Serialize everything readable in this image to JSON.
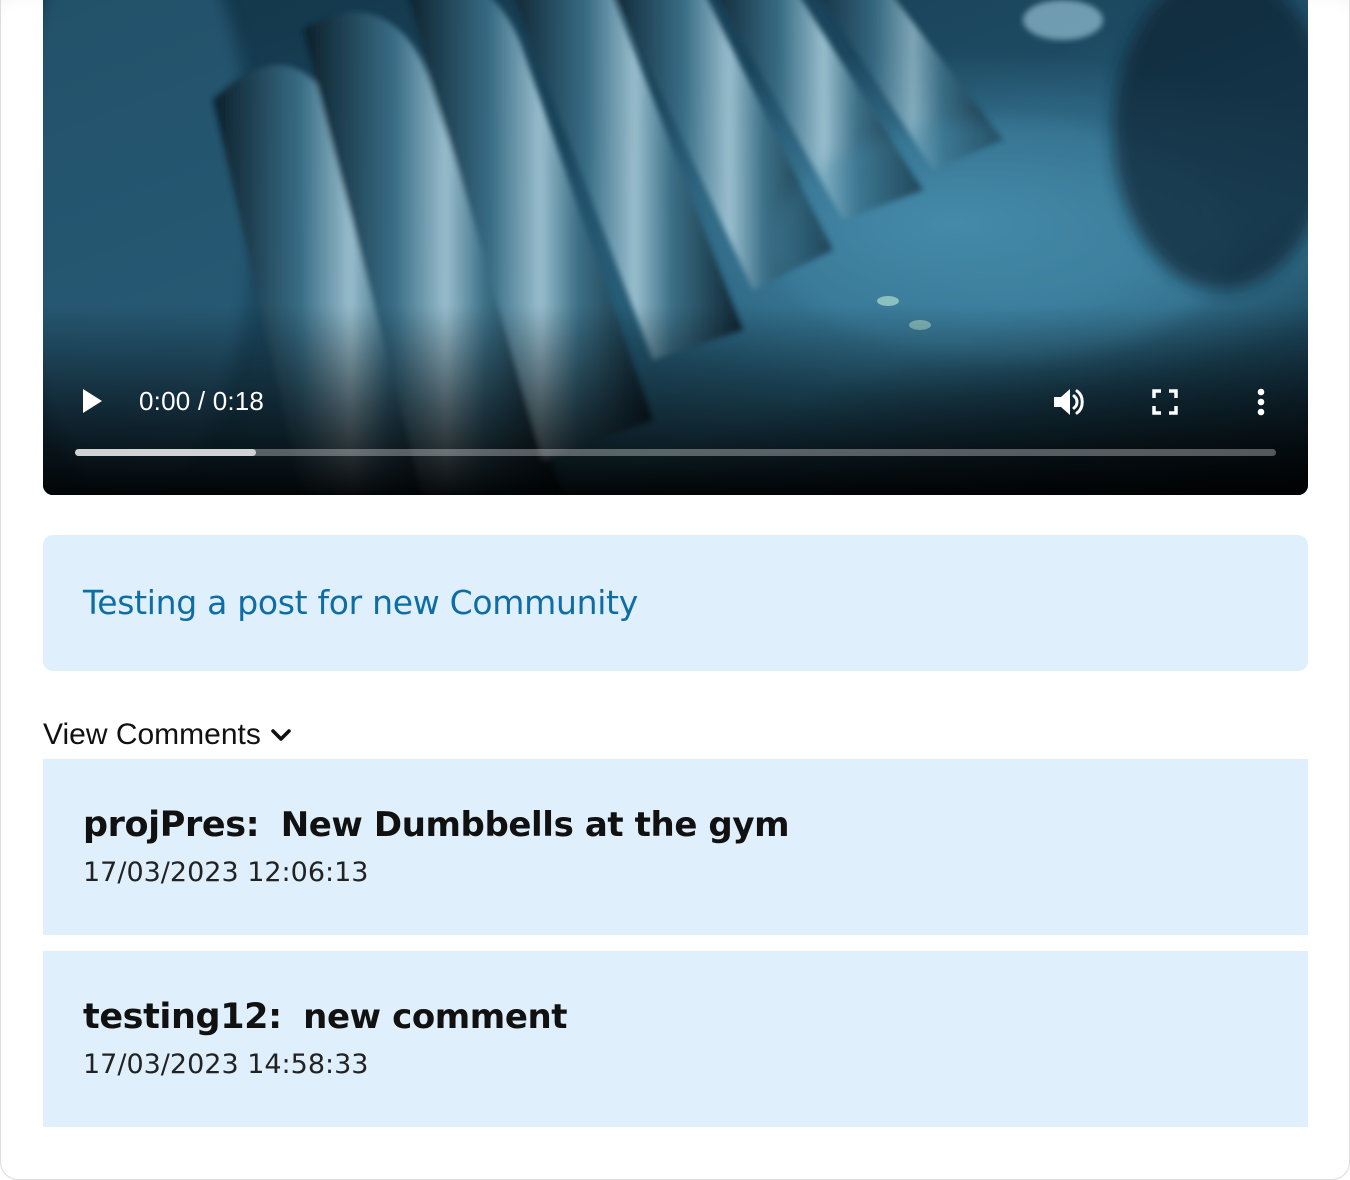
{
  "video": {
    "current_time": "0:00",
    "separator": " / ",
    "duration": "0:18",
    "buffered_fraction": 0.151,
    "played_fraction": 0.0,
    "controls": {
      "play_icon": "play-icon",
      "volume_icon": "volume-icon",
      "fullscreen_icon": "fullscreen-icon",
      "more_icon": "more-vertical-icon"
    },
    "colors": {
      "frame_dark": "#06121a",
      "frame_mid": "#1f4b63",
      "frame_highlight": "#6fa7c2"
    }
  },
  "post": {
    "title": "Testing a post for new Community",
    "colors": {
      "background": "#dff0fc",
      "title": "#0f6da6"
    }
  },
  "comments_toggle": {
    "label": "View Comments",
    "icon": "chevron-down-icon"
  },
  "comments": [
    {
      "author": "projPres:",
      "text": "New Dumbbells at the gym",
      "timestamp": "17/03/2023 12:06:13"
    },
    {
      "author": "testing12:",
      "text": "new comment",
      "timestamp": "17/03/2023 14:58:33"
    }
  ]
}
